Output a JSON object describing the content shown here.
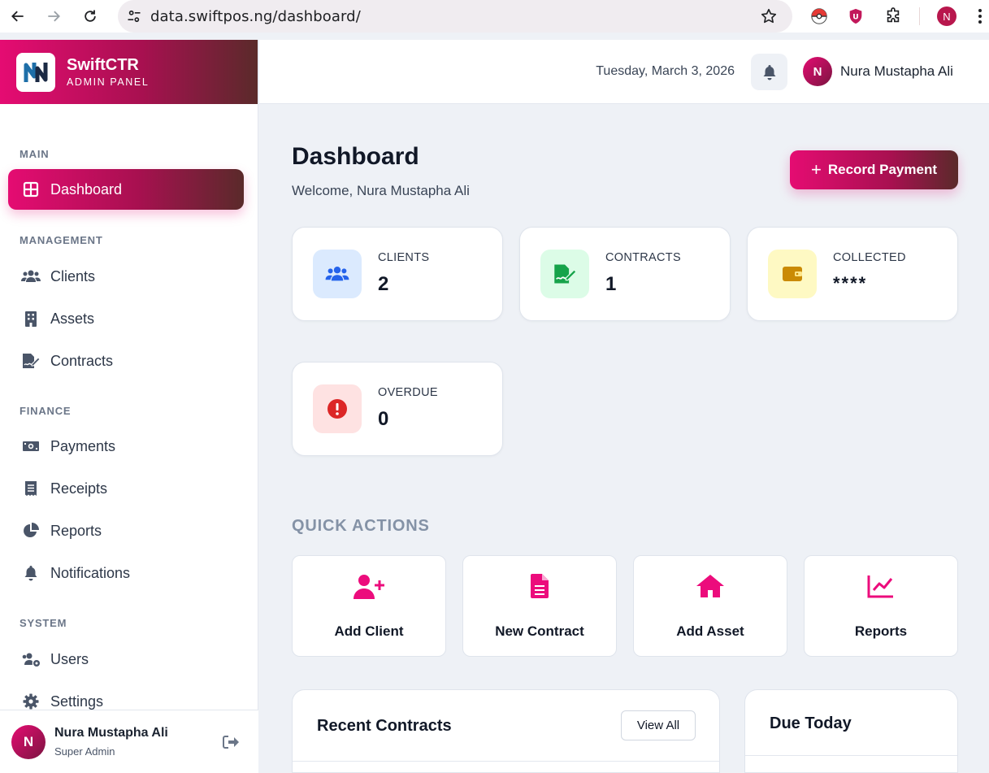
{
  "browser": {
    "url": "data.swiftpos.ng/dashboard/",
    "profile_initial": "N"
  },
  "brand": {
    "title": "SwiftCTR",
    "subtitle": "ADMIN PANEL",
    "accent": "#e50c72"
  },
  "sidebar": {
    "sections": {
      "main": "MAIN",
      "management": "MANAGEMENT",
      "finance": "FINANCE",
      "system": "SYSTEM"
    },
    "items": [
      {
        "label": "Dashboard",
        "icon": "dashboard-grid-icon",
        "active": true
      },
      {
        "label": "Clients",
        "icon": "users-icon"
      },
      {
        "label": "Assets",
        "icon": "building-icon"
      },
      {
        "label": "Contracts",
        "icon": "file-signature-icon"
      },
      {
        "label": "Payments",
        "icon": "money-icon"
      },
      {
        "label": "Receipts",
        "icon": "receipt-icon"
      },
      {
        "label": "Reports",
        "icon": "pie-chart-icon"
      },
      {
        "label": "Notifications",
        "icon": "bell-icon"
      },
      {
        "label": "Users",
        "icon": "users-cog-icon"
      },
      {
        "label": "Settings",
        "icon": "gear-icon"
      }
    ],
    "footer": {
      "initial": "N",
      "name": "Nura Mustapha Ali",
      "role": "Super Admin"
    }
  },
  "topbar": {
    "date": "Tuesday, March 3, 2026",
    "user_initial": "N",
    "user_name": "Nura Mustapha Ali"
  },
  "header": {
    "title": "Dashboard",
    "welcome": "Welcome, Nura Mustapha Ali",
    "record_payment": "Record Payment"
  },
  "stats": [
    {
      "label": "CLIENTS",
      "value": "2",
      "icon": "users-icon",
      "color": "#2563eb",
      "bg": "#dbeafe"
    },
    {
      "label": "CONTRACTS",
      "value": "1",
      "icon": "file-signature-icon",
      "color": "#16a34a",
      "bg": "#dcfce7"
    },
    {
      "label": "COLLECTED",
      "value": "****",
      "icon": "wallet-icon",
      "color": "#ca8a04",
      "bg": "#fef9c3"
    },
    {
      "label": "OVERDUE",
      "value": "0",
      "icon": "alert-circle-icon",
      "color": "#dc2626",
      "bg": "#fee2e2"
    }
  ],
  "quick_actions": {
    "title": "QUICK ACTIONS",
    "items": [
      {
        "label": "Add Client",
        "icon": "user-plus-icon"
      },
      {
        "label": "New Contract",
        "icon": "document-icon"
      },
      {
        "label": "Add Asset",
        "icon": "home-icon"
      },
      {
        "label": "Reports",
        "icon": "line-chart-icon"
      }
    ]
  },
  "recent_contracts": {
    "title": "Recent Contracts",
    "view_all": "View All"
  },
  "due_today": {
    "title": "Due Today"
  }
}
